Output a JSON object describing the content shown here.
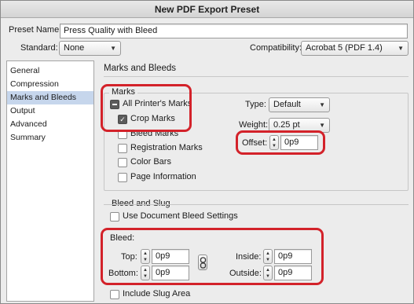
{
  "window": {
    "title": "New PDF Export Preset"
  },
  "preset": {
    "label": "Preset Name:",
    "value": "Press Quality with Bleed"
  },
  "standard": {
    "label": "Standard:",
    "value": "None"
  },
  "compatibility": {
    "label": "Compatibility:",
    "value": "Acrobat 5 (PDF 1.4)"
  },
  "sidebar": {
    "items": [
      {
        "label": "General",
        "selected": false
      },
      {
        "label": "Compression",
        "selected": false
      },
      {
        "label": "Marks and Bleeds",
        "selected": true
      },
      {
        "label": "Output",
        "selected": false
      },
      {
        "label": "Advanced",
        "selected": false
      },
      {
        "label": "Summary",
        "selected": false
      }
    ]
  },
  "panel": {
    "title": "Marks and Bleeds"
  },
  "marks": {
    "group_label": "Marks",
    "all_printers_marks": "All Printer's Marks",
    "crop_marks": "Crop Marks",
    "bleed_marks": "Bleed Marks",
    "registration_marks": "Registration Marks",
    "color_bars": "Color Bars",
    "page_information": "Page Information",
    "type_label": "Type:",
    "type_value": "Default",
    "weight_label": "Weight:",
    "weight_value": "0.25 pt",
    "offset_label": "Offset:",
    "offset_value": "0p9"
  },
  "bleed_slug": {
    "group_label": "Bleed and Slug",
    "use_document_bleed": "Use Document Bleed Settings",
    "bleed_label": "Bleed:",
    "top_label": "Top:",
    "top_value": "0p9",
    "bottom_label": "Bottom:",
    "bottom_value": "0p9",
    "inside_label": "Inside:",
    "inside_value": "0p9",
    "outside_label": "Outside:",
    "outside_value": "0p9",
    "include_slug": "Include Slug Area"
  },
  "colors": {
    "highlight": "#d3222a",
    "selection": "#c6d6ec"
  },
  "icons": {
    "stepper": "stepper-arrows-icon",
    "chain": "chain-link-icon",
    "dropdown": "chevron-down-icon"
  }
}
